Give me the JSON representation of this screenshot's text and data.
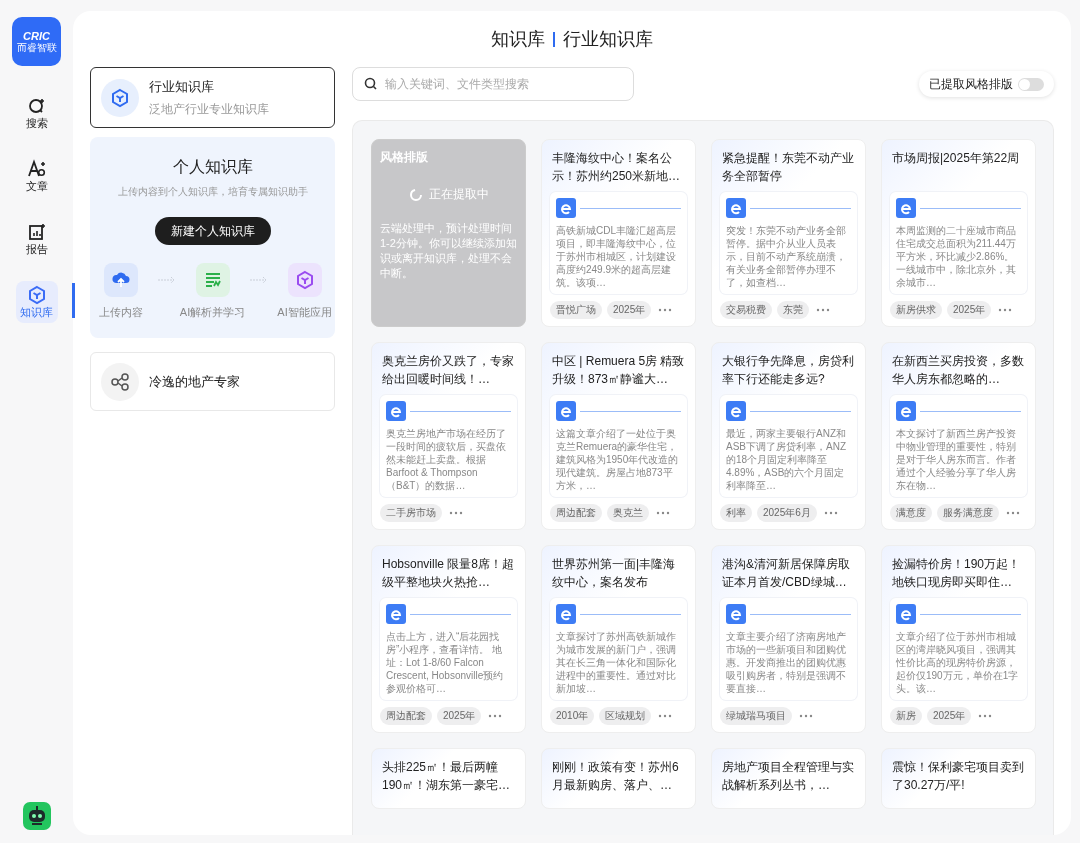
{
  "sidebar": {
    "logo": {
      "brand": "CRIC",
      "subtitle": "而睿智联"
    },
    "nav": [
      {
        "label": "搜索",
        "selected": false
      },
      {
        "label": "文章",
        "selected": false
      },
      {
        "label": "报告",
        "selected": false
      },
      {
        "label": "知识库",
        "selected": true
      }
    ]
  },
  "header": {
    "parent": "知识库",
    "current": "行业知识库"
  },
  "libraries": [
    {
      "title": "行业知识库",
      "subtitle": "泛地产行业专业知识库",
      "selected": true
    }
  ],
  "personal": {
    "title": "个人知识库",
    "description": "上传内容到个人知识库，培育专属知识助手",
    "button": "新建个人知识库",
    "steps": [
      {
        "label": "上传内容"
      },
      {
        "label": "AI解析并学习"
      },
      {
        "label": "AI智能应用"
      }
    ]
  },
  "experts": [
    {
      "name": "冷逸的地产专家",
      "selected": false
    }
  ],
  "search": {
    "placeholder": "输入关键词、文件类型搜索"
  },
  "toggle": {
    "label": "已提取风格排版",
    "on": false
  },
  "cards": [
    {
      "kind": "processing",
      "title": "风格排版",
      "status": "正在提取中",
      "message": "云端处理中，预计处理时间1-2分钟。你可以继续添加知识或离开知识库，处理不会中断。"
    },
    {
      "kind": "article",
      "title": "丰隆海纹中心！案名公示！苏州约250米新地…",
      "summary": "高铁新城CDL丰隆汇超高层项目，即丰隆海纹中心，位于苏州市相城区，计划建设高度约249.9米的超高层建筑。该项…",
      "tags": [
        "晋悦广场",
        "2025年"
      ]
    },
    {
      "kind": "article",
      "title": "紧急提醒！东莞不动产业务全部暂停",
      "summary": "突发！东莞不动产业务全部暂停。据中介从业人员表示，目前不动产系统崩溃，有关业务全部暂停办理不了，如查档…",
      "tags": [
        "交易税费",
        "东莞"
      ]
    },
    {
      "kind": "article",
      "title": "市场周报|2025年第22周",
      "summary": "本周监测的二十座城市商品住宅成交总面积为211.44万平方米，环比减少2.86%。一线城市中，除北京外，其余城市…",
      "tags": [
        "新房供求",
        "2025年"
      ]
    },
    {
      "kind": "article",
      "title": "奥克兰房价又跌了，专家给出回暖时间线！…",
      "summary": "奥克兰房地产市场在经历了一段时间的疲软后，买盘依然未能赶上卖盘。根据Barfoot & Thompson（B&T）的数据…",
      "tags": [
        "二手房市场"
      ]
    },
    {
      "kind": "article",
      "title": "中区 | Remuera 5房 精致升级！873㎡静谧大…",
      "summary": "这篇文章介绍了一处位于奥克兰Remuera的豪华住宅，建筑风格为1950年代改造的现代建筑。房屋占地873平方米，…",
      "tags": [
        "周边配套",
        "奥克兰"
      ]
    },
    {
      "kind": "article",
      "title": "大银行争先降息，房贷利率下行还能走多远?",
      "summary": "最近，两家主要银行ANZ和ASB下调了房贷利率，ANZ的18个月固定利率降至4.89%，ASB的六个月固定利率降至…",
      "tags": [
        "利率",
        "2025年6月"
      ]
    },
    {
      "kind": "article",
      "title": "在新西兰买房投资，多数华人房东都忽略的…",
      "summary": "本文探讨了新西兰房产投资中物业管理的重要性，特别是对于华人房东而言。作者通过个人经验分享了华人房东在物…",
      "tags": [
        "满意度",
        "服务满意度"
      ]
    },
    {
      "kind": "article",
      "title": "Hobsonville 限量8席！超级平整地块火热抢…",
      "summary": "点击上方，进入“后花园找房”小程序，查看详情。 地址：Lot 1-8/60 Falcon Crescent, Hobsonville预约参观价格可…",
      "tags": [
        "周边配套",
        "2025年"
      ]
    },
    {
      "kind": "article",
      "title": "世界苏州第一面|丰隆海纹中心，案名发布",
      "summary": "文章探讨了苏州高铁新城作为城市发展的新门户，强调其在长三角一体化和国际化进程中的重要性。通过对比新加坡…",
      "tags": [
        "2010年",
        "区域规划"
      ]
    },
    {
      "kind": "article",
      "title": "港沟&清河新居保障房取证本月首发/CBD绿城…",
      "summary": "文章主要介绍了济南房地产市场的一些新项目和团购优惠。开发商推出的团购优惠吸引购房者，特别是强调不要直接…",
      "tags": [
        "绿城瑞马项目"
      ]
    },
    {
      "kind": "article",
      "title": "捡漏特价房！190万起！地铁口现房即买即住…",
      "summary": "文章介绍了位于苏州市相城区的湾岸晓风项目，强调其性价比高的现房特价房源，起价仅190万元，单价在1字头。该…",
      "tags": [
        "新房",
        "2025年"
      ]
    },
    {
      "kind": "article",
      "title": "头排225㎡！最后两幢190㎡！湖东第一豪宅…"
    },
    {
      "kind": "article",
      "title": "刚刚！政策有变！苏州6月最新购房、落户、…"
    },
    {
      "kind": "article",
      "title": "房地产项目全程管理与实战解析系列丛书，…"
    },
    {
      "kind": "article",
      "title": "震惊！保利豪宅项目卖到了30.27万/平!"
    }
  ]
}
